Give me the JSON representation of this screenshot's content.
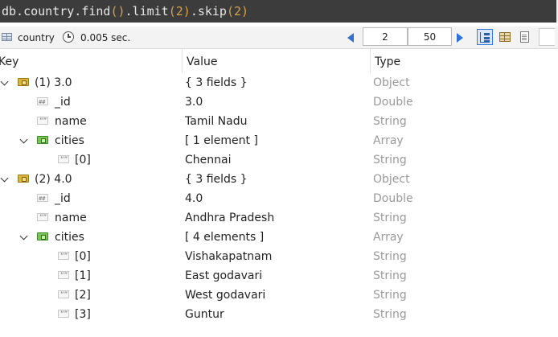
{
  "query": {
    "prefix": "db.country.find",
    "p1": "()",
    "mid1": ".limit",
    "p2": "(2)",
    "mid2": ".skip",
    "p3": "(2)"
  },
  "toolbar": {
    "collection": "country",
    "time": "0.005 sec.",
    "skip_value": "2",
    "limit_value": "50"
  },
  "columns": {
    "key": "Key",
    "value": "Value",
    "type": "Type"
  },
  "rows": [
    {
      "key": "(1) 3.0",
      "value": "{ 3 fields }",
      "type": "Object"
    },
    {
      "key": "_id",
      "value": "3.0",
      "type": "Double"
    },
    {
      "key": "name",
      "value": "Tamil Nadu",
      "type": "String"
    },
    {
      "key": "cities",
      "value": "[ 1 element ]",
      "type": "Array"
    },
    {
      "key": "[0]",
      "value": "Chennai",
      "type": "String"
    },
    {
      "key": "(2) 4.0",
      "value": "{ 3 fields }",
      "type": "Object"
    },
    {
      "key": "_id",
      "value": "4.0",
      "type": "Double"
    },
    {
      "key": "name",
      "value": "Andhra Pradesh",
      "type": "String"
    },
    {
      "key": "cities",
      "value": "[ 4 elements ]",
      "type": "Array"
    },
    {
      "key": "[0]",
      "value": "Vishakapatnam",
      "type": "String"
    },
    {
      "key": "[1]",
      "value": "East godavari",
      "type": "String"
    },
    {
      "key": "[2]",
      "value": "West godavari",
      "type": "String"
    },
    {
      "key": "[3]",
      "value": "Guntur",
      "type": "String"
    }
  ]
}
